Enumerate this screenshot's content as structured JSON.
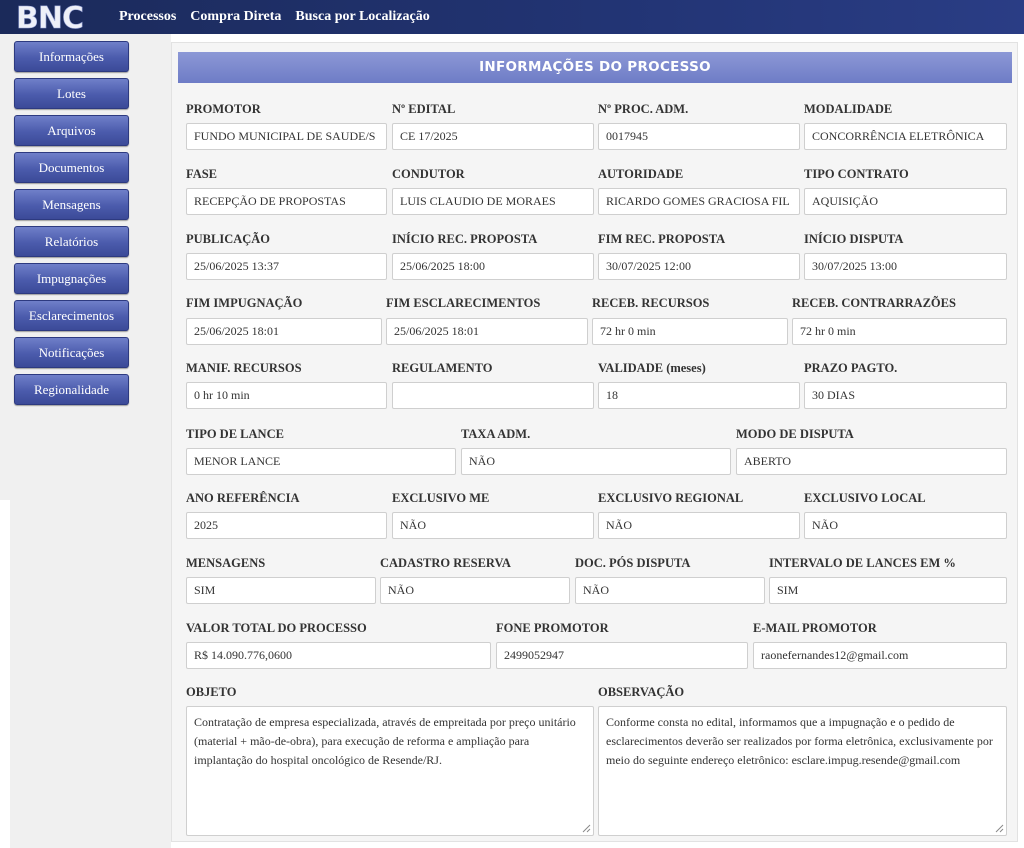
{
  "topbar": {
    "logo_text": "BNC",
    "nav": [
      "Processos",
      "Compra Direta",
      "Busca por Localização"
    ]
  },
  "sidebar": {
    "items": [
      "Informações",
      "Lotes",
      "Arquivos",
      "Documentos",
      "Mensagens",
      "Relatórios",
      "Impugnações",
      "Esclarecimentos",
      "Notificações",
      "Regionalidade"
    ]
  },
  "panel": {
    "title": "INFORMAÇÕES DO PROCESSO"
  },
  "fields": {
    "promotor": {
      "label": "PROMOTOR",
      "value": "FUNDO MUNICIPAL DE SAUDE/S"
    },
    "edital": {
      "label": "Nº EDITAL",
      "value": "CE 17/2025"
    },
    "proc_adm": {
      "label": "Nº PROC. ADM.",
      "value": "0017945"
    },
    "modalidade": {
      "label": "MODALIDADE",
      "value": "CONCORRÊNCIA ELETRÔNICA"
    },
    "fase": {
      "label": "FASE",
      "value": "RECEPÇÃO DE PROPOSTAS"
    },
    "condutor": {
      "label": "CONDUTOR",
      "value": "LUIS CLAUDIO DE MORAES"
    },
    "autoridade": {
      "label": "AUTORIDADE",
      "value": "RICARDO GOMES GRACIOSA FIL"
    },
    "tipo_contrato": {
      "label": "TIPO CONTRATO",
      "value": "AQUISIÇÃO"
    },
    "publicacao": {
      "label": "PUBLICAÇÃO",
      "value": "25/06/2025 13:37"
    },
    "inicio_rec": {
      "label": "INÍCIO REC. PROPOSTA",
      "value": "25/06/2025 18:00"
    },
    "fim_rec": {
      "label": "FIM REC. PROPOSTA",
      "value": "30/07/2025 12:00"
    },
    "inicio_disputa": {
      "label": "INÍCIO DISPUTA",
      "value": "30/07/2025 13:00"
    },
    "fim_impugnacao": {
      "label": "FIM IMPUGNAÇÃO",
      "value": "25/06/2025 18:01"
    },
    "fim_esclarecimentos": {
      "label": "FIM ESCLARECIMENTOS",
      "value": "25/06/2025 18:01"
    },
    "receb_recursos": {
      "label": "RECEB. RECURSOS",
      "value": "72 hr 0 min"
    },
    "receb_contrarrazoes": {
      "label": "RECEB. CONTRARRAZÕES",
      "value": "72 hr 0 min"
    },
    "manif_recursos": {
      "label": "MANIF. RECURSOS",
      "value": "0 hr 10 min"
    },
    "regulamento": {
      "label": "REGULAMENTO",
      "value": ""
    },
    "validade": {
      "label": "VALIDADE (meses)",
      "value": "18"
    },
    "prazo_pagto": {
      "label": "PRAZO PAGTO.",
      "value": "30 DIAS"
    },
    "tipo_lance": {
      "label": "TIPO DE LANCE",
      "value": "MENOR LANCE"
    },
    "taxa_adm": {
      "label": "TAXA ADM.",
      "value": "NÃO"
    },
    "modo_disputa": {
      "label": "MODO DE DISPUTA",
      "value": "ABERTO"
    },
    "ano_referencia": {
      "label": "ANO REFERÊNCIA",
      "value": "2025"
    },
    "exclusivo_me": {
      "label": "EXCLUSIVO ME",
      "value": "NÃO"
    },
    "exclusivo_regional": {
      "label": "EXCLUSIVO REGIONAL",
      "value": "NÃO"
    },
    "exclusivo_local": {
      "label": "EXCLUSIVO LOCAL",
      "value": "NÃO"
    },
    "mensagens": {
      "label": "MENSAGENS",
      "value": "SIM"
    },
    "cadastro_reserva": {
      "label": "CADASTRO RESERVA",
      "value": "NÃO"
    },
    "doc_pos_disputa": {
      "label": "DOC. PÓS DISPUTA",
      "value": "NÃO"
    },
    "intervalo_lances": {
      "label": "INTERVALO DE LANCES EM %",
      "value": "SIM"
    },
    "valor_total": {
      "label": "VALOR TOTAL DO PROCESSO",
      "value": "R$ 14.090.776,0600"
    },
    "fone_promotor": {
      "label": "FONE PROMOTOR",
      "value": "2499052947"
    },
    "email_promotor": {
      "label": "E-MAIL PROMOTOR",
      "value": "raonefernandes12@gmail.com"
    },
    "objeto": {
      "label": "OBJETO",
      "value": "Contratação de empresa especializada, através de empreitada por preço unitário (material + mão-de-obra), para execução de reforma e ampliação para implantação do hospital oncológico de Resende/RJ."
    },
    "observacao": {
      "label": "OBSERVAÇÃO",
      "value": "Conforme consta no edital, informamos que a impugnação e o pedido de esclarecimentos deverão ser realizados por forma eletrônica, exclusivamente por meio do seguinte endereço eletrônico: esclare.impug.resende@gmail.com"
    }
  },
  "colors": {
    "topbar": "#223474",
    "button": "#4b5bac",
    "header": "#7b88cc"
  }
}
